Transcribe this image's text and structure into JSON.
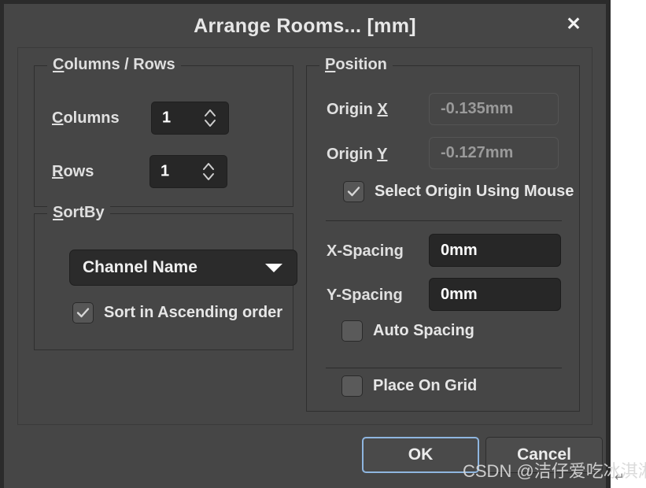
{
  "window": {
    "title": "Arrange Rooms... [mm]",
    "close_icon": "close-icon",
    "close_glyph": "✕",
    "background": "#464646",
    "titlebar_background": "#464646"
  },
  "columns_rows_group": {
    "legend_prefix": "",
    "legend_accel": "C",
    "legend_rest": "olumns / Rows",
    "legend": "Columns / Rows",
    "columns": {
      "label_accel": "C",
      "label_rest": "olumns",
      "label": "Columns",
      "value": "1",
      "spinner_up_icon": "chevron-up-icon",
      "spinner_down_icon": "chevron-down-icon"
    },
    "rows": {
      "label_accel": "R",
      "label_rest": "ows",
      "label": "Rows",
      "value": "1",
      "spinner_up_icon": "chevron-up-icon",
      "spinner_down_icon": "chevron-down-icon"
    }
  },
  "sortby_group": {
    "legend_accel": "S",
    "legend_rest": "ortBy",
    "legend": "SortBy",
    "dropdown": {
      "selected": "Channel Name",
      "arrow_icon": "chevron-down-icon"
    },
    "ascending_checkbox": {
      "label": "Sort in Ascending order",
      "checked": true,
      "icon": "checkmark-icon"
    }
  },
  "position_group": {
    "legend_accel": "P",
    "legend_rest": "osition",
    "legend": "Position",
    "origin_x": {
      "label_prefix": "Origin ",
      "label_accel": "X",
      "label": "Origin X",
      "value": "-0.135mm",
      "enabled": false
    },
    "origin_y": {
      "label_prefix": "Origin ",
      "label_accel": "Y",
      "label": "Origin Y",
      "value": "-0.127mm",
      "enabled": false
    },
    "select_origin_checkbox": {
      "label": "Select Origin Using Mouse",
      "checked": true,
      "icon": "checkmark-icon"
    },
    "x_spacing": {
      "label": "X-Spacing",
      "value": "0mm",
      "enabled": true
    },
    "y_spacing": {
      "label": "Y-Spacing",
      "value": "0mm",
      "enabled": true
    },
    "auto_spacing_checkbox": {
      "label": "Auto Spacing",
      "checked": false
    },
    "place_on_grid_checkbox": {
      "label": "Place On Grid",
      "checked": false
    }
  },
  "footer": {
    "ok_label": "OK",
    "cancel_label": "Cancel",
    "focus_color": "#8fb6e0"
  },
  "watermark": {
    "text": "CSDN @洁仔爱吃冰淇淋",
    "mark": "↵"
  }
}
